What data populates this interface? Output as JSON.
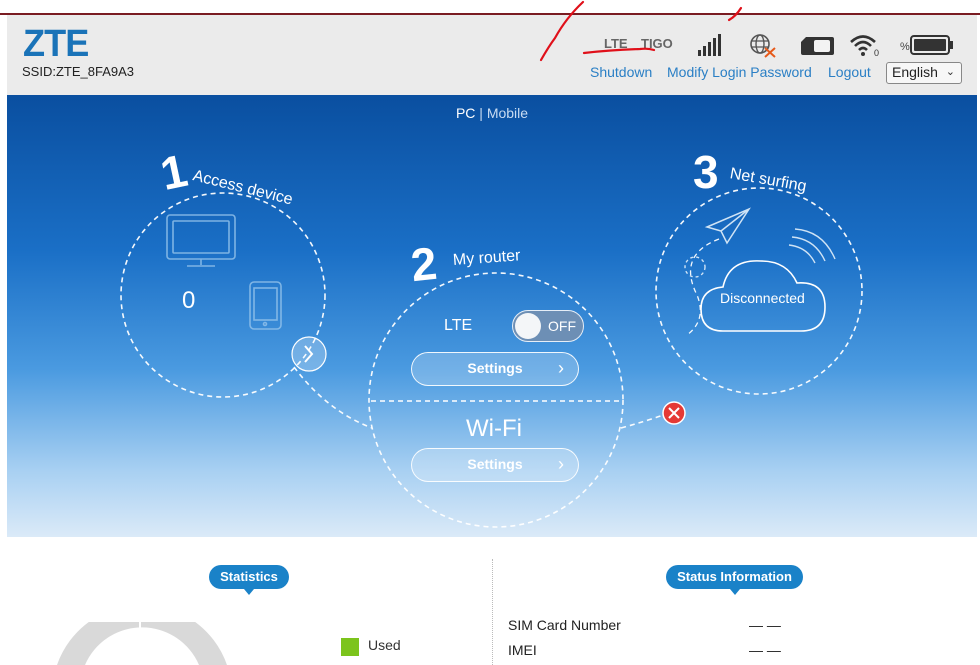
{
  "header": {
    "brand": "ZTE",
    "ssid": "SSID:ZTE_8FA9A3",
    "network_type": "LTE",
    "operator": "TIGO",
    "battery_label": "%",
    "links": {
      "shutdown": "Shutdown",
      "modify_password": "Modify Login Password",
      "logout": "Logout"
    },
    "language": "English"
  },
  "hero": {
    "view_pc": "PC",
    "view_sep": "|",
    "view_mobile": "Mobile",
    "step1": {
      "number": "1",
      "title": "Access device",
      "device_count": "0"
    },
    "step2": {
      "number": "2",
      "title": "My router",
      "lte_label": "LTE",
      "toggle_state": "OFF",
      "settings_label": "Settings",
      "wifi_label": "Wi-Fi",
      "wifi_settings_label": "Settings"
    },
    "step3": {
      "number": "3",
      "title": "Net surfing",
      "status": "Disconnected"
    }
  },
  "bottom": {
    "statistics_tag": "Statistics",
    "status_tag": "Status Information",
    "legend_used": "Used",
    "rows": [
      {
        "label": "SIM Card Number",
        "value": "— —"
      },
      {
        "label": "IMEI",
        "value": "— —"
      }
    ]
  },
  "colors": {
    "accent": "#1a82c8",
    "brand": "#1a73b8",
    "used": "#7cc41c",
    "error": "#e53935",
    "annotation": "#e0101a"
  },
  "icons": [
    "signal-bars-icon",
    "globe-disconnected-icon",
    "sim-card-icon",
    "wifi-icon",
    "battery-icon",
    "monitor-icon",
    "phone-icon",
    "chevron-right-icon",
    "paper-plane-icon",
    "cloud-icon",
    "close-icon"
  ]
}
